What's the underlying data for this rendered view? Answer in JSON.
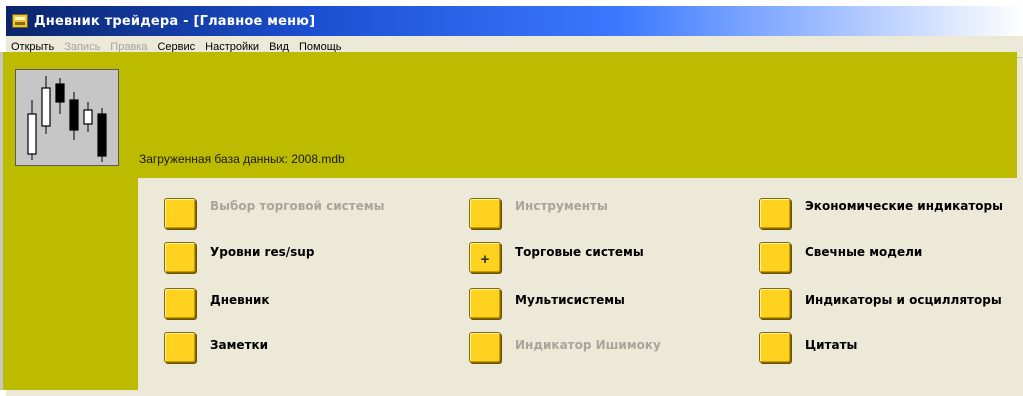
{
  "window": {
    "title": "Дневник трейдера - [Главное меню]",
    "app_icon": "app-icon"
  },
  "menu": [
    {
      "label": "Открыть",
      "enabled": true
    },
    {
      "label": "Запись",
      "enabled": false
    },
    {
      "label": "Правка",
      "enabled": false
    },
    {
      "label": "Сервис",
      "enabled": true
    },
    {
      "label": "Настройки",
      "enabled": true
    },
    {
      "label": "Вид",
      "enabled": true
    },
    {
      "label": "Помощь",
      "enabled": true
    }
  ],
  "status": {
    "db_label": "Загруженная база данных: 2008.mdb"
  },
  "buttons": {
    "col1": [
      {
        "label": "Выбор торговой системы",
        "enabled": false
      },
      {
        "label": "Уровни res/sup",
        "enabled": true
      },
      {
        "label": "Дневник",
        "enabled": true
      },
      {
        "label": "Заметки",
        "enabled": true
      }
    ],
    "col2": [
      {
        "label": "Инструменты",
        "enabled": false
      },
      {
        "label": "Торговые системы",
        "enabled": true,
        "mark": "+"
      },
      {
        "label": "Мультисистемы",
        "enabled": true
      },
      {
        "label": "Индикатор Ишимоку",
        "enabled": false
      }
    ],
    "col3": [
      {
        "label": "Экономические индикаторы",
        "enabled": true
      },
      {
        "label": "Свечные модели",
        "enabled": true
      },
      {
        "label": "Индикаторы и осцилляторы",
        "enabled": true
      },
      {
        "label": "Цитаты",
        "enabled": true
      }
    ]
  },
  "colors": {
    "olive_bg": "#bdbb00",
    "panel_bg": "#ece9d8",
    "button_yellow": "#ffd21f",
    "disabled_text": "#a8a59a"
  }
}
